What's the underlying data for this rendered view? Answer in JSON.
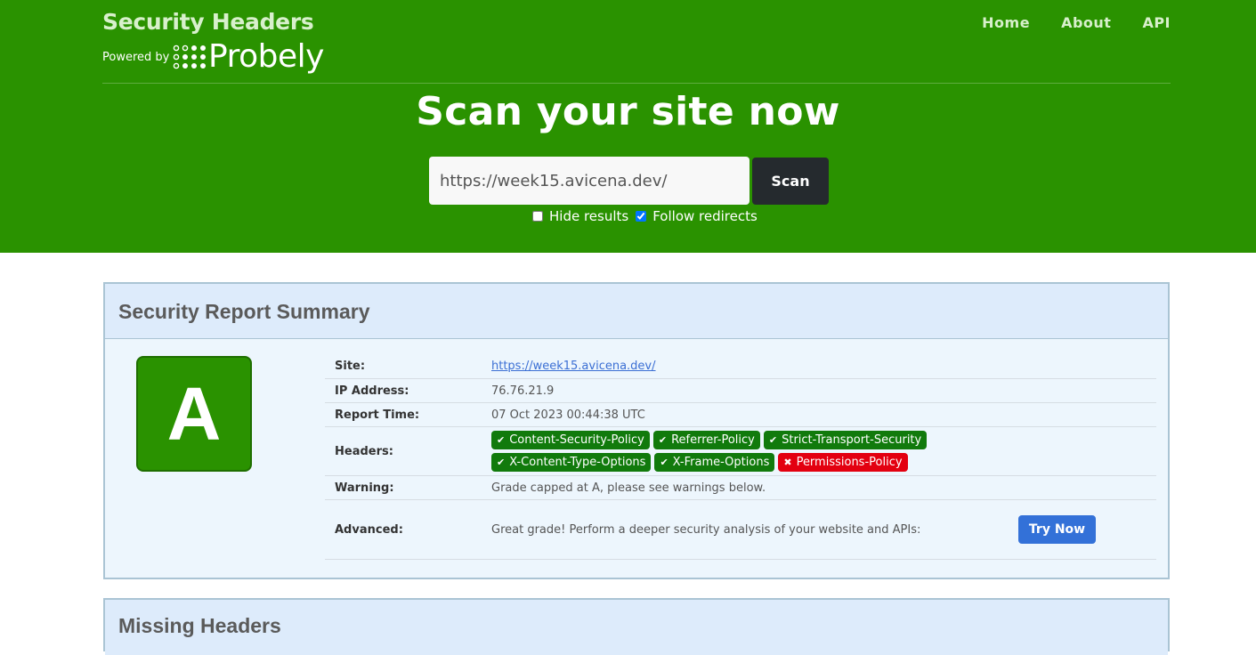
{
  "header": {
    "brand_title": "Security Headers",
    "powered_by": "Powered by",
    "probely": "Probely",
    "nav": [
      "Home",
      "About",
      "API"
    ]
  },
  "scan": {
    "headline": "Scan your site now",
    "url_value": "https://week15.avicena.dev/",
    "scan_label": "Scan",
    "hide_results_label": "Hide results",
    "hide_results_checked": false,
    "follow_redirects_label": "Follow redirects",
    "follow_redirects_checked": true
  },
  "summary": {
    "title": "Security Report Summary",
    "grade": "A",
    "site_label": "Site:",
    "site_value": "https://week15.avicena.dev/",
    "ip_label": "IP Address:",
    "ip_value": "76.76.21.9",
    "time_label": "Report Time:",
    "time_value": "07 Oct 2023 00:44:38 UTC",
    "headers_label": "Headers:",
    "headers": [
      {
        "name": "Content-Security-Policy",
        "status": "ok"
      },
      {
        "name": "Referrer-Policy",
        "status": "ok"
      },
      {
        "name": "Strict-Transport-Security",
        "status": "ok"
      },
      {
        "name": "X-Content-Type-Options",
        "status": "ok"
      },
      {
        "name": "X-Frame-Options",
        "status": "ok"
      },
      {
        "name": "Permissions-Policy",
        "status": "missing"
      }
    ],
    "warning_label": "Warning:",
    "warning_value": "Grade capped at A, please see warnings below.",
    "advanced_label": "Advanced:",
    "advanced_value": "Great grade! Perform a deeper security analysis of your website and APIs:",
    "try_now_label": "Try Now"
  },
  "missing": {
    "title": "Missing Headers"
  },
  "colors": {
    "header_green": "#2a9200",
    "badge_ok": "#117a0c",
    "badge_missing": "#e30010",
    "button_blue": "#3371d8"
  }
}
